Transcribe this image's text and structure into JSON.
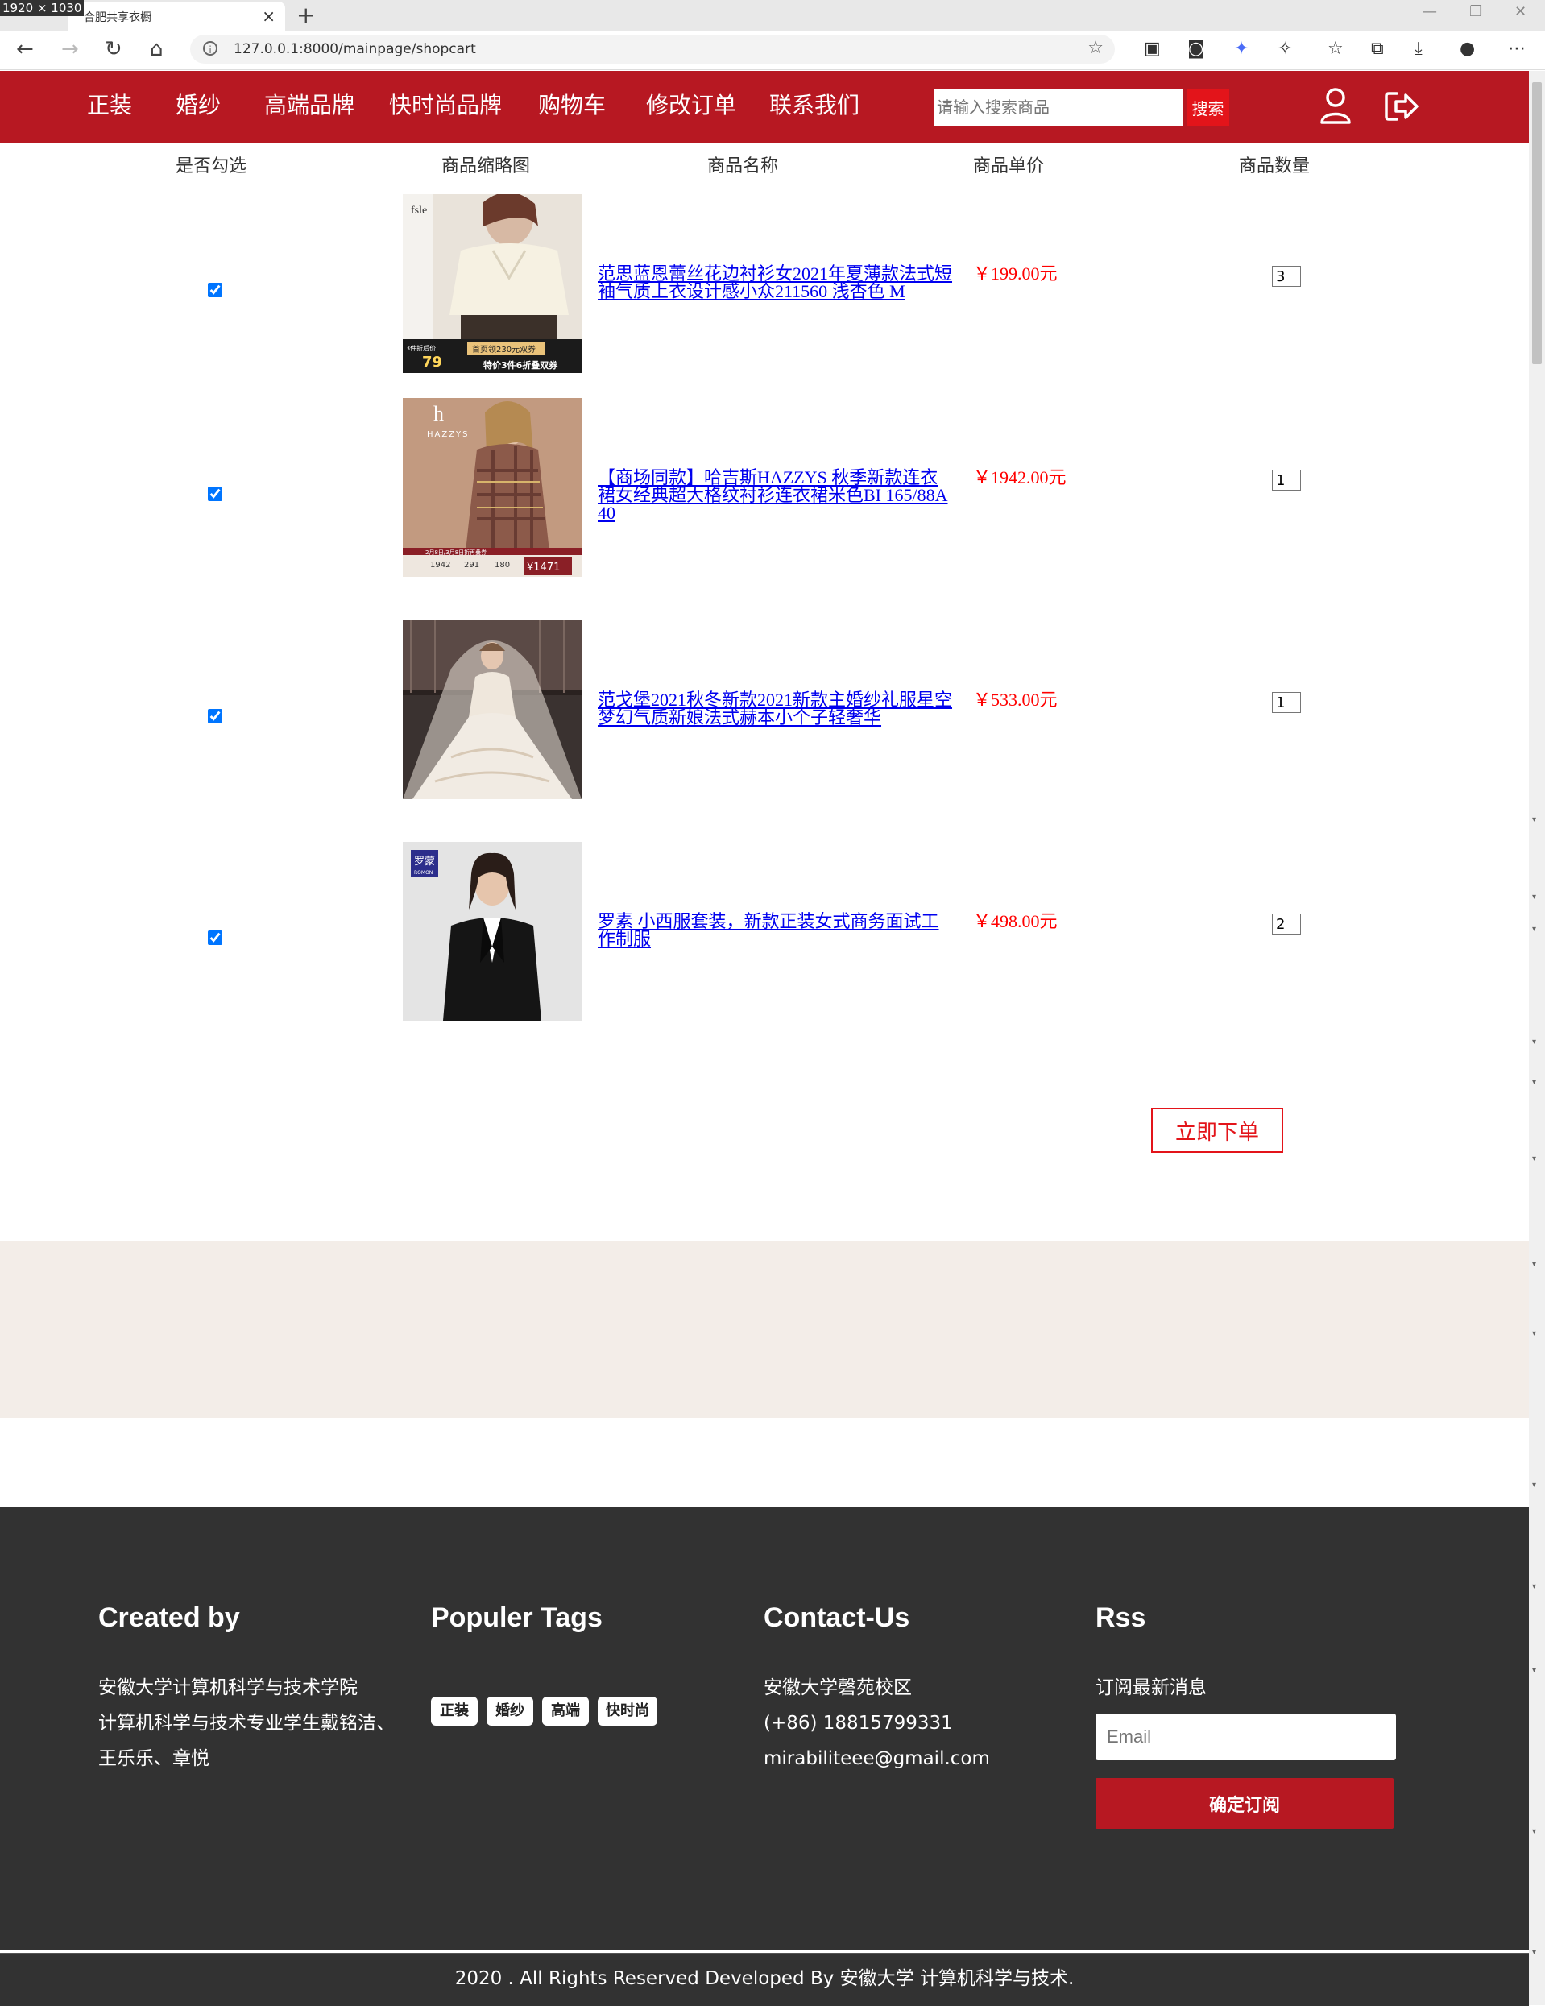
{
  "chrome": {
    "dimension_badge": "1920 × 1030",
    "tab_title": "合肥共享衣橱",
    "url": "127.0.0.1:8000/mainpage/shopcart"
  },
  "header": {
    "menu": [
      "正装",
      "婚纱",
      "高端品牌",
      "快时尚品牌",
      "购物车",
      "修改订单",
      "联系我们"
    ],
    "search_placeholder": "请输入搜索商品",
    "search_button": "搜索"
  },
  "cart": {
    "columns": [
      "是否勾选",
      "商品缩略图",
      "商品名称",
      "商品单价",
      "商品数量"
    ],
    "items": [
      {
        "checked": true,
        "name": "范思蓝恩蕾丝花边衬衫女2021年夏薄款法式短袖气质上衣设计感小众211560 浅杏色 M",
        "price": "￥199.00元",
        "quantity": "3",
        "thumb_brand": "fsle",
        "thumb_price": "79",
        "thumb_promo": "首页领230元双券",
        "thumb_bottom": "特价3件6折叠双券",
        "thumb_note": "3件折后价"
      },
      {
        "checked": true,
        "name": "【商场同款】哈吉斯HAZZYS 秋季新款连衣裙女经典超大格纹衬衫连衣裙米色BI 165/88A 40",
        "price": "￥1942.00元",
        "quantity": "1",
        "thumb_brand": "HAZZYS",
        "thumb_logo": "h",
        "thumb_prices": [
          "1942",
          "291",
          "180",
          "¥1471"
        ],
        "thumb_banner": "2月8日/3月8日折再叠券"
      },
      {
        "checked": true,
        "name": "范戈堡2021秋冬新款2021新款主婚纱礼服星空梦幻气质新娘法式赫本小个子轻奢华",
        "price": "￥533.00元",
        "quantity": "1"
      },
      {
        "checked": true,
        "name": "罗素 小西服套装，新款正装女式商务面试工作制服",
        "price": "￥498.00元",
        "quantity": "2",
        "thumb_logo": "罗蒙",
        "thumb_logo_sub": "ROMON"
      }
    ],
    "order_button": "立即下单"
  },
  "footer": {
    "created_by": {
      "heading": "Created by",
      "lines": [
        "安徽大学计算机科学与技术学院",
        "计算机科学与技术专业学生戴铭洁、",
        "王乐乐、章悦"
      ]
    },
    "tags": {
      "heading": "Populer Tags",
      "items": [
        "正装",
        "婚纱",
        "高端",
        "快时尚"
      ]
    },
    "contact": {
      "heading": "Contact-Us",
      "lines": [
        "安徽大学磬苑校区",
        "(+86) 18815799331",
        "mirabiliteee@gmail.com"
      ]
    },
    "rss": {
      "heading": "Rss",
      "text": "订阅最新消息",
      "email_placeholder": "Email",
      "button": "确定订阅"
    },
    "copyright": "2020 . All Rights Reserved Developed By 安徽大学 计算机科学与技术."
  },
  "colors": {
    "brand_red": "#b71822",
    "button_red": "#e3141a",
    "price_red": "#ff0000",
    "footer_bg": "#323232",
    "beige_band": "#f3ede8"
  },
  "icons": [
    "back-icon",
    "forward-icon",
    "reload-icon",
    "home-icon",
    "info-icon",
    "favorite-add-icon",
    "user-icon",
    "logout-icon",
    "collections-icon",
    "downloads-icon",
    "extensions-icon",
    "more-icon"
  ]
}
